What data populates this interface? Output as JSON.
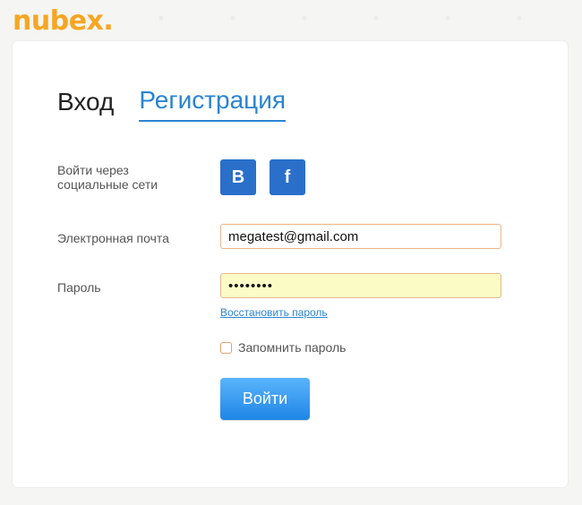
{
  "brand": {
    "logo_text": "nubex",
    "logo_dot": "."
  },
  "tabs": {
    "login": "Вход",
    "register": "Регистрация"
  },
  "social": {
    "label": "Войти через социальные сети",
    "vk_label": "B",
    "fb_label": "f"
  },
  "email": {
    "label": "Электронная почта",
    "value": "megatest@gmail.com"
  },
  "password": {
    "label": "Пароль",
    "value": "••••••••",
    "restore_link": "Восстановить пароль"
  },
  "remember": {
    "label": "Запомнить пароль",
    "checked": false
  },
  "submit": {
    "label": "Войти"
  },
  "colors": {
    "accent": "#2a84d2",
    "brand": "#f6a623",
    "button": "#2a6fc9"
  }
}
